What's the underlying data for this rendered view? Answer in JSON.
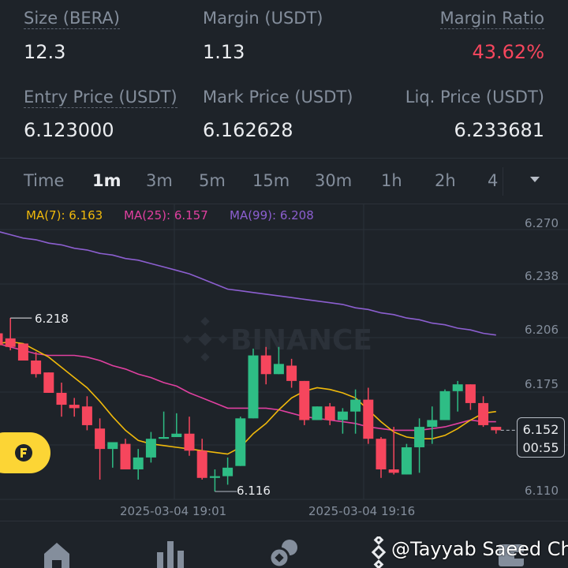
{
  "position": {
    "size_label": "Size (BERA)",
    "size_value": "12.3",
    "margin_label": "Margin (USDT)",
    "margin_value": "1.13",
    "margin_ratio_label": "Margin Ratio",
    "margin_ratio_value": "43.62%",
    "entry_label": "Entry Price (USDT)",
    "entry_value": "6.123000",
    "mark_label": "Mark Price (USDT)",
    "mark_value": "6.162628",
    "liq_label": "Liq. Price (USDT)",
    "liq_value": "6.233681"
  },
  "intervals": [
    "Time",
    "1m",
    "3m",
    "5m",
    "15m",
    "30m",
    "1h",
    "2h",
    "4"
  ],
  "active_interval": "1m",
  "indicators": {
    "ma7": "MA(7): 6.163",
    "ma25": "MA(25): 6.157",
    "ma99": "MA(99): 6.208"
  },
  "watermark": "BINANCE",
  "colors": {
    "up": "#2ebd85",
    "down": "#f6465d",
    "ma7": "#f0b90b",
    "ma25": "#e040a0",
    "ma99": "#8c5fd0",
    "ratio": "#f6465d"
  },
  "chart_data": {
    "type": "candlestick",
    "y_ticks": [
      "6.270",
      "6.238",
      "6.206",
      "6.175",
      "6.110"
    ],
    "ylim": [
      6.11,
      6.27
    ],
    "x_labels": [
      "2025-03-04 19:01",
      "2025-03-04 19:16"
    ],
    "high_label": "6.218",
    "low_label": "6.116",
    "current_price": "6.152",
    "countdown": "00:55",
    "ohlc": [
      [
        6.209,
        6.209,
        6.201,
        6.202
      ],
      [
        6.206,
        6.218,
        6.199,
        6.201
      ],
      [
        6.203,
        6.203,
        6.193,
        6.193
      ],
      [
        6.193,
        6.198,
        6.183,
        6.185
      ],
      [
        6.186,
        6.186,
        6.174,
        6.174
      ],
      [
        6.174,
        6.18,
        6.16,
        6.167
      ],
      [
        6.167,
        6.171,
        6.16,
        6.165
      ],
      [
        6.166,
        6.172,
        6.152,
        6.155
      ],
      [
        6.153,
        6.159,
        6.123,
        6.141
      ],
      [
        6.141,
        6.145,
        6.13,
        6.145
      ],
      [
        6.144,
        6.147,
        6.129,
        6.129
      ],
      [
        6.129,
        6.141,
        6.123,
        6.136
      ],
      [
        6.136,
        6.151,
        6.133,
        6.147
      ],
      [
        6.147,
        6.163,
        6.147,
        6.148
      ],
      [
        6.148,
        6.162,
        6.148,
        6.15
      ],
      [
        6.15,
        6.16,
        6.137,
        6.14
      ],
      [
        6.14,
        6.147,
        6.123,
        6.124
      ],
      [
        6.124,
        6.129,
        6.116,
        6.125
      ],
      [
        6.125,
        6.136,
        6.12,
        6.13
      ],
      [
        6.131,
        6.16,
        6.131,
        6.159
      ],
      [
        6.159,
        6.2,
        6.159,
        6.196
      ],
      [
        6.196,
        6.201,
        6.179,
        6.185
      ],
      [
        6.185,
        6.201,
        6.185,
        6.191
      ],
      [
        6.19,
        6.194,
        6.177,
        6.181
      ],
      [
        6.181,
        6.181,
        6.155,
        6.158
      ],
      [
        6.158,
        6.166,
        6.158,
        6.166
      ],
      [
        6.166,
        6.168,
        6.155,
        6.158
      ],
      [
        6.158,
        6.165,
        6.15,
        6.163
      ],
      [
        6.163,
        6.176,
        6.15,
        6.17
      ],
      [
        6.17,
        6.177,
        6.144,
        6.147
      ],
      [
        6.147,
        6.148,
        6.124,
        6.129
      ],
      [
        6.129,
        6.154,
        6.126,
        6.127
      ],
      [
        6.126,
        6.144,
        6.126,
        6.142
      ],
      [
        6.142,
        6.159,
        6.127,
        6.154
      ],
      [
        6.154,
        6.166,
        6.144,
        6.158
      ],
      [
        6.158,
        6.176,
        6.158,
        6.175
      ],
      [
        6.175,
        6.181,
        6.163,
        6.179
      ],
      [
        6.179,
        6.179,
        6.164,
        6.168
      ],
      [
        6.168,
        6.172,
        6.154,
        6.155
      ],
      [
        6.154,
        6.154,
        6.15,
        6.152
      ]
    ],
    "ma7": [
      6.203,
      6.204,
      6.203,
      6.199,
      6.195,
      6.189,
      6.183,
      6.177,
      6.169,
      6.16,
      6.152,
      6.146,
      6.144,
      6.143,
      6.142,
      6.141,
      6.14,
      6.139,
      6.138,
      6.142,
      6.15,
      6.156,
      6.164,
      6.171,
      6.175,
      6.177,
      6.176,
      6.174,
      6.171,
      6.164,
      6.157,
      6.151,
      6.148,
      6.147,
      6.147,
      6.149,
      6.153,
      6.158,
      6.162,
      6.163
    ],
    "ma25": [
      6.203,
      6.201,
      6.199,
      6.197,
      6.196,
      6.196,
      6.196,
      6.195,
      6.193,
      6.19,
      6.188,
      6.185,
      6.183,
      6.18,
      6.178,
      6.174,
      6.171,
      6.168,
      6.165,
      6.165,
      6.165,
      6.165,
      6.164,
      6.162,
      6.16,
      6.159,
      6.158,
      6.157,
      6.156,
      6.154,
      6.153,
      6.152,
      6.152,
      6.152,
      6.153,
      6.154,
      6.156,
      6.158,
      6.157,
      6.157
    ],
    "ma99": [
      6.269,
      6.267,
      6.265,
      6.264,
      6.262,
      6.261,
      6.259,
      6.258,
      6.256,
      6.255,
      6.253,
      6.252,
      6.25,
      6.248,
      6.246,
      6.244,
      6.241,
      6.238,
      6.235,
      6.234,
      6.233,
      6.232,
      6.231,
      6.23,
      6.229,
      6.228,
      6.227,
      6.226,
      6.224,
      6.223,
      6.221,
      6.22,
      6.218,
      6.217,
      6.215,
      6.214,
      6.212,
      6.211,
      6.209,
      6.208
    ]
  },
  "nav": [
    "home-icon",
    "markets-icon",
    "trade-icon",
    "futures-icon",
    "wallet-icon"
  ],
  "overlay_text": "@Tayyab Saeed Ch"
}
